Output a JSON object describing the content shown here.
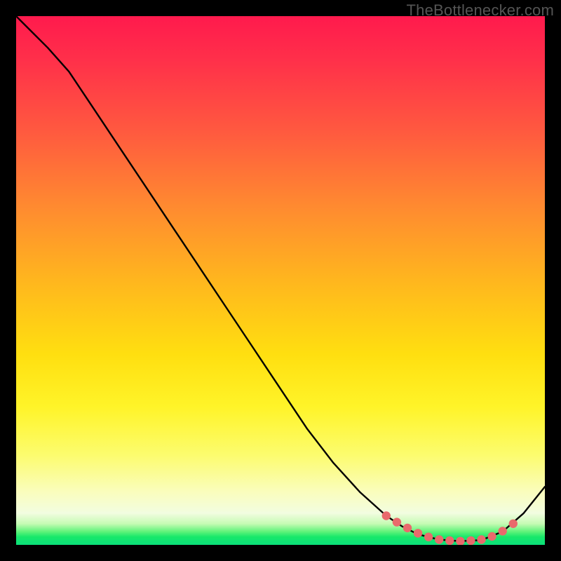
{
  "watermark": "TheBottlenecker.com",
  "colors": {
    "line": "#000000",
    "marker": "#e96a6c"
  },
  "chart_data": {
    "type": "line",
    "title": "",
    "xlabel": "",
    "ylabel": "",
    "xlim": [
      0,
      100
    ],
    "ylim": [
      0,
      100
    ],
    "series": [
      {
        "name": "curve",
        "x": [
          0,
          3,
          6,
          10,
          15,
          20,
          25,
          30,
          35,
          40,
          45,
          50,
          55,
          60,
          65,
          70,
          73,
          76,
          80,
          84,
          88,
          92,
          96,
          100
        ],
        "y": [
          100,
          97,
          94,
          89.5,
          82,
          74.5,
          67,
          59.5,
          52,
          44.5,
          37,
          29.5,
          22,
          15.5,
          10,
          5.5,
          3.5,
          2,
          1,
          0.7,
          0.9,
          2.5,
          6,
          11
        ]
      }
    ],
    "markers": {
      "name": "optimum-band",
      "x": [
        70,
        72,
        74,
        76,
        78,
        80,
        82,
        84,
        86,
        88,
        90,
        92,
        94
      ],
      "y": [
        5.5,
        4.3,
        3.2,
        2.2,
        1.5,
        1.0,
        0.8,
        0.7,
        0.8,
        1.0,
        1.6,
        2.6,
        4.0
      ]
    }
  }
}
